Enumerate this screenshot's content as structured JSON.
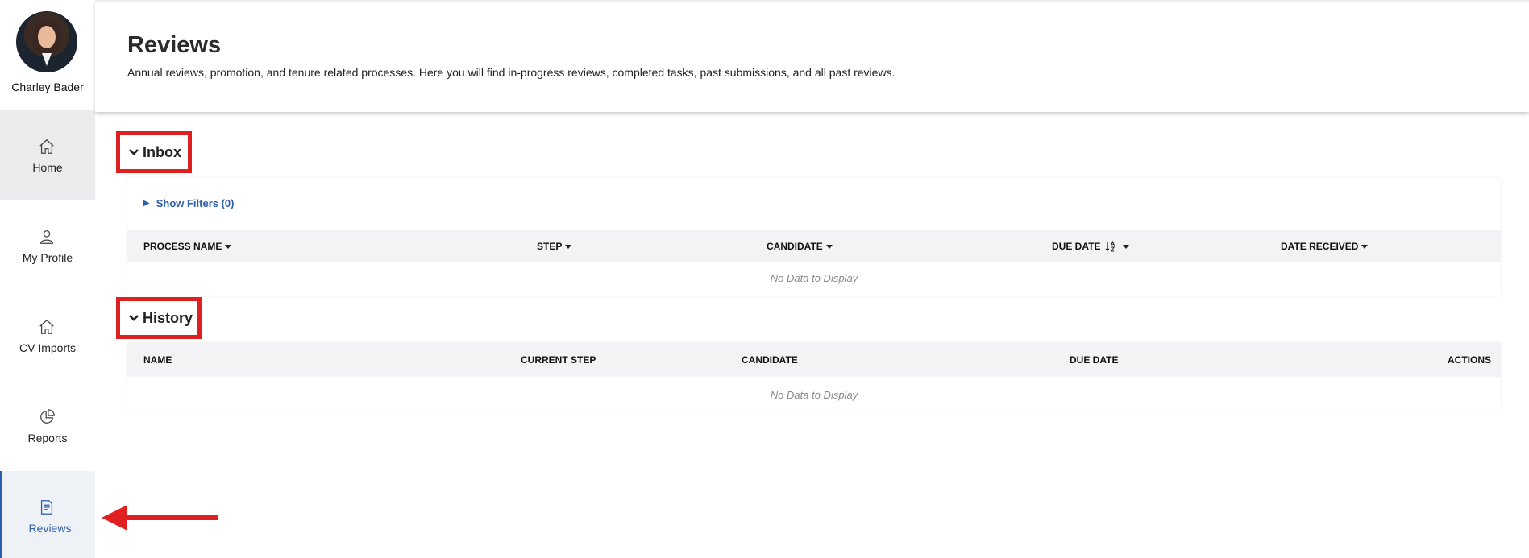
{
  "user": {
    "name": "Charley Bader"
  },
  "nav": {
    "items": [
      {
        "label": "Home",
        "icon": "home-icon"
      },
      {
        "label": "My Profile",
        "icon": "user-icon"
      },
      {
        "label": "CV Imports",
        "icon": "home-icon"
      },
      {
        "label": "Reports",
        "icon": "pie-chart-icon"
      },
      {
        "label": "Reviews",
        "icon": "document-icon",
        "active": true
      }
    ]
  },
  "header": {
    "title": "Reviews",
    "description": "Annual reviews, promotion, and tenure related processes. Here you will find in-progress reviews, completed tasks, past submissions, and all past reviews."
  },
  "inbox": {
    "title": "Inbox",
    "filters_label": "Show Filters (0)",
    "columns": [
      "PROCESS NAME",
      "STEP",
      "CANDIDATE",
      "DUE DATE",
      "DATE RECEIVED"
    ],
    "empty_text": "No Data to Display"
  },
  "history": {
    "title": "History",
    "columns": [
      "NAME",
      "CURRENT STEP",
      "CANDIDATE",
      "DUE DATE",
      "ACTIONS"
    ],
    "empty_text": "No Data to Display"
  },
  "colors": {
    "accent": "#2b5fa8",
    "annotation_red": "#e02020"
  }
}
